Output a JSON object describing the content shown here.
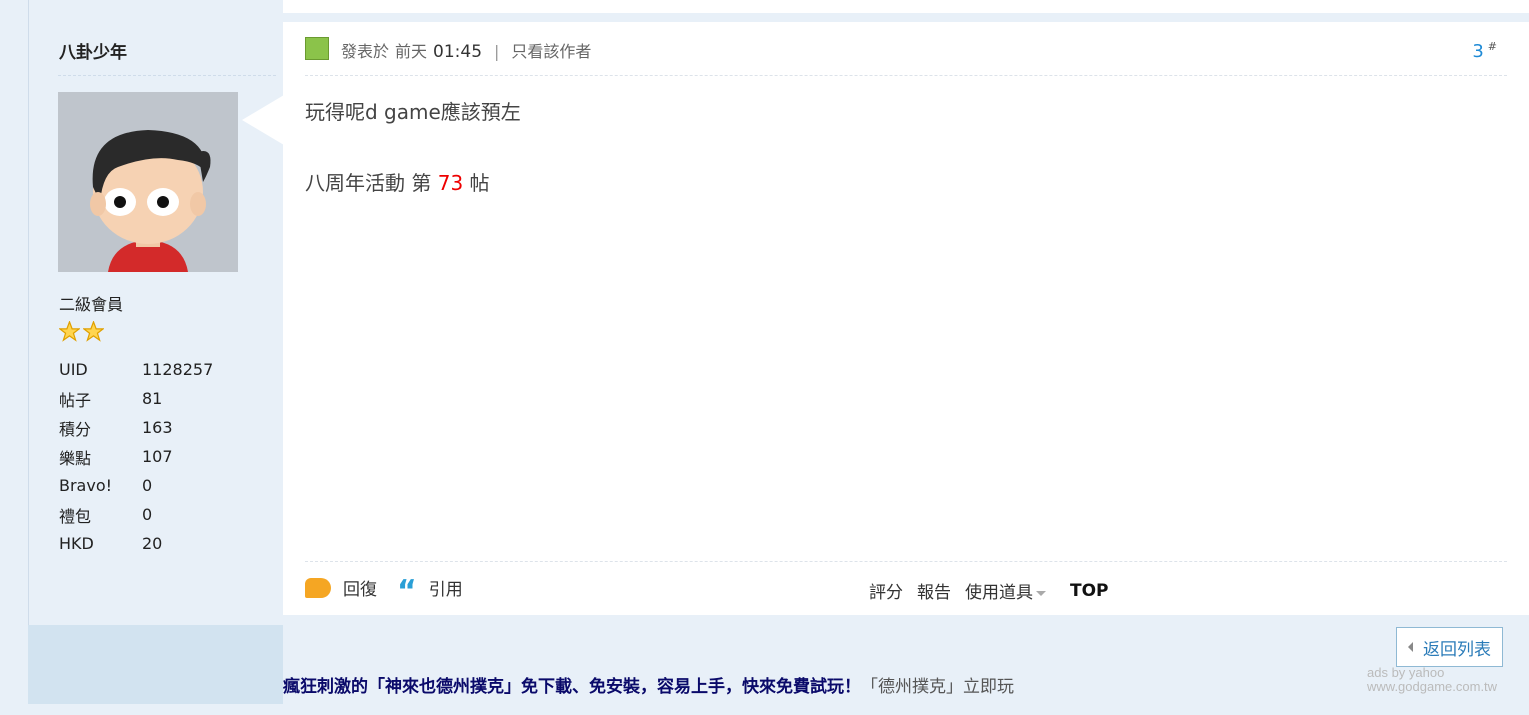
{
  "author": {
    "username": "八卦少年",
    "rank": "二級會員",
    "stars": 2,
    "stats": [
      {
        "label": "UID",
        "value": "1128257"
      },
      {
        "label": "帖子",
        "value": "81"
      },
      {
        "label": "積分",
        "value": "163"
      },
      {
        "label": "樂點",
        "value": "107"
      },
      {
        "label": "Bravo!",
        "value": "0"
      },
      {
        "label": "禮包",
        "value": "0"
      },
      {
        "label": "HKD",
        "value": "20"
      }
    ]
  },
  "post": {
    "posted_label": "發表於",
    "posted_day": "前天",
    "posted_time": "01:45",
    "separator": "|",
    "only_author": "只看該作者",
    "floor": "3",
    "floor_mark": "#",
    "content_line1": "玩得呢d game應該預左",
    "event_prefix": "八周年活動 第",
    "event_number": "73",
    "event_suffix": "帖"
  },
  "actions": {
    "reply": "回復",
    "quote": "引用",
    "rate": "評分",
    "report": "報告",
    "use_item": "使用道具",
    "top": "TOP"
  },
  "back_to_list": "返回列表",
  "ad": {
    "headline": "瘋狂刺激的「神來也德州撲克」免下載、免安裝，容易上手，快來免費試玩！",
    "tail": "「德州撲克」立即玩",
    "tag_line1": "ads by yahoo",
    "tag_line2": "www.godgame.com.tw"
  },
  "colors": {
    "background": "#e8f0f8",
    "accent": "#1e8ad6",
    "highlight": "#e00000"
  }
}
